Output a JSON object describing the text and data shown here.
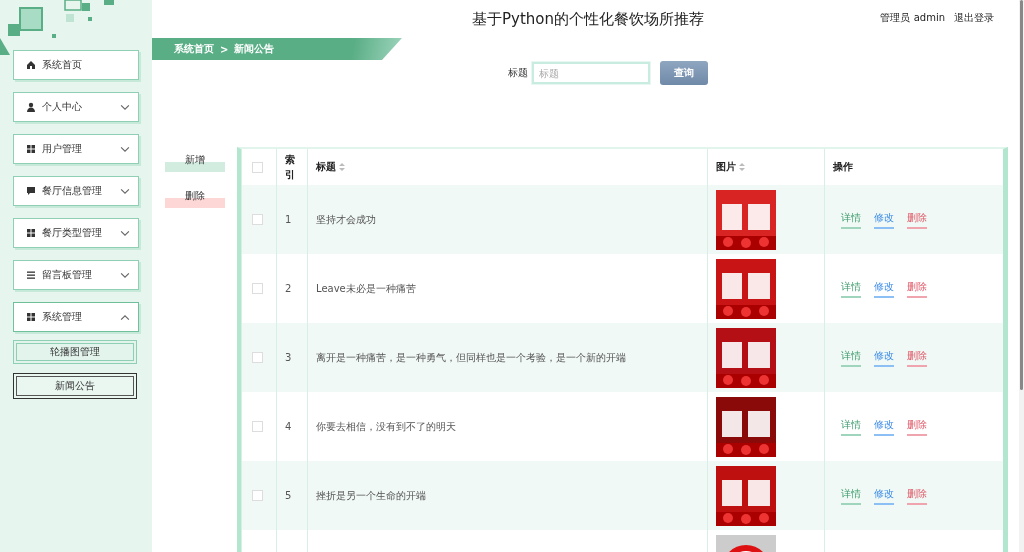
{
  "header": {
    "title": "基于Python的个性化餐饮场所推荐",
    "user": "管理员 admin",
    "logout": "退出登录"
  },
  "sidebar": {
    "menu": [
      {
        "label": "系统首页",
        "kind": "link"
      },
      {
        "label": "个人中心",
        "kind": "group",
        "expanded": false
      },
      {
        "label": "用户管理",
        "kind": "group",
        "expanded": false
      },
      {
        "label": "餐厅信息管理",
        "kind": "group",
        "expanded": false
      },
      {
        "label": "餐厅类型管理",
        "kind": "group",
        "expanded": false
      },
      {
        "label": "留言板管理",
        "kind": "group",
        "expanded": false
      },
      {
        "label": "系统管理",
        "kind": "group",
        "expanded": true,
        "children": [
          {
            "label": "轮播图管理",
            "selected": false
          },
          {
            "label": "新闻公告",
            "selected": true
          }
        ]
      }
    ]
  },
  "breadcrumb": {
    "items": [
      "系统首页",
      "新闻公告"
    ],
    "separator": ">"
  },
  "search": {
    "label": "标题",
    "placeholder": "标题",
    "button": "查询"
  },
  "toolbar": [
    {
      "label": "新增",
      "kind": "add"
    },
    {
      "label": "删除",
      "kind": "delete"
    }
  ],
  "table": {
    "header_checked": false,
    "columns": [
      {
        "label": "索引",
        "sortable": false
      },
      {
        "label": "标题",
        "sortable": true
      },
      {
        "label": "图片",
        "sortable": true
      },
      {
        "label": "操作",
        "sortable": false
      }
    ],
    "rows": [
      {
        "checked": false,
        "index": "1",
        "title": "坚持才会成功",
        "image": {
          "kind": "picture"
        },
        "actions": [
          {
            "label": "详情",
            "kind": "detail"
          },
          {
            "label": "修改",
            "kind": "edit"
          },
          {
            "label": "删除",
            "kind": "delete"
          }
        ]
      },
      {
        "checked": false,
        "index": "2",
        "title": "Leave未必是一种痛苦",
        "image": {
          "kind": "picture"
        },
        "actions": [
          {
            "label": "详情",
            "kind": "detail"
          },
          {
            "label": "修改",
            "kind": "edit"
          },
          {
            "label": "删除",
            "kind": "delete"
          }
        ]
      },
      {
        "checked": false,
        "index": "3",
        "title": "离开是一种痛苦，是一种勇气，但同样也是一个考验，是一个新的开端",
        "image": {
          "kind": "picture"
        },
        "actions": [
          {
            "label": "详情",
            "kind": "detail"
          },
          {
            "label": "修改",
            "kind": "edit"
          },
          {
            "label": "删除",
            "kind": "delete"
          }
        ]
      },
      {
        "checked": false,
        "index": "4",
        "title": "你要去相信，没有到不了的明天",
        "image": {
          "kind": "picture"
        },
        "actions": [
          {
            "label": "详情",
            "kind": "detail"
          },
          {
            "label": "修改",
            "kind": "edit"
          },
          {
            "label": "删除",
            "kind": "delete"
          }
        ]
      },
      {
        "checked": false,
        "index": "5",
        "title": "挫折是另一个生命的开端",
        "image": {
          "kind": "picture"
        },
        "actions": [
          {
            "label": "详情",
            "kind": "detail"
          },
          {
            "label": "修改",
            "kind": "edit"
          },
          {
            "label": "删除",
            "kind": "delete"
          }
        ]
      },
      {
        "image": {
          "kind": "picture"
        }
      }
    ]
  }
}
